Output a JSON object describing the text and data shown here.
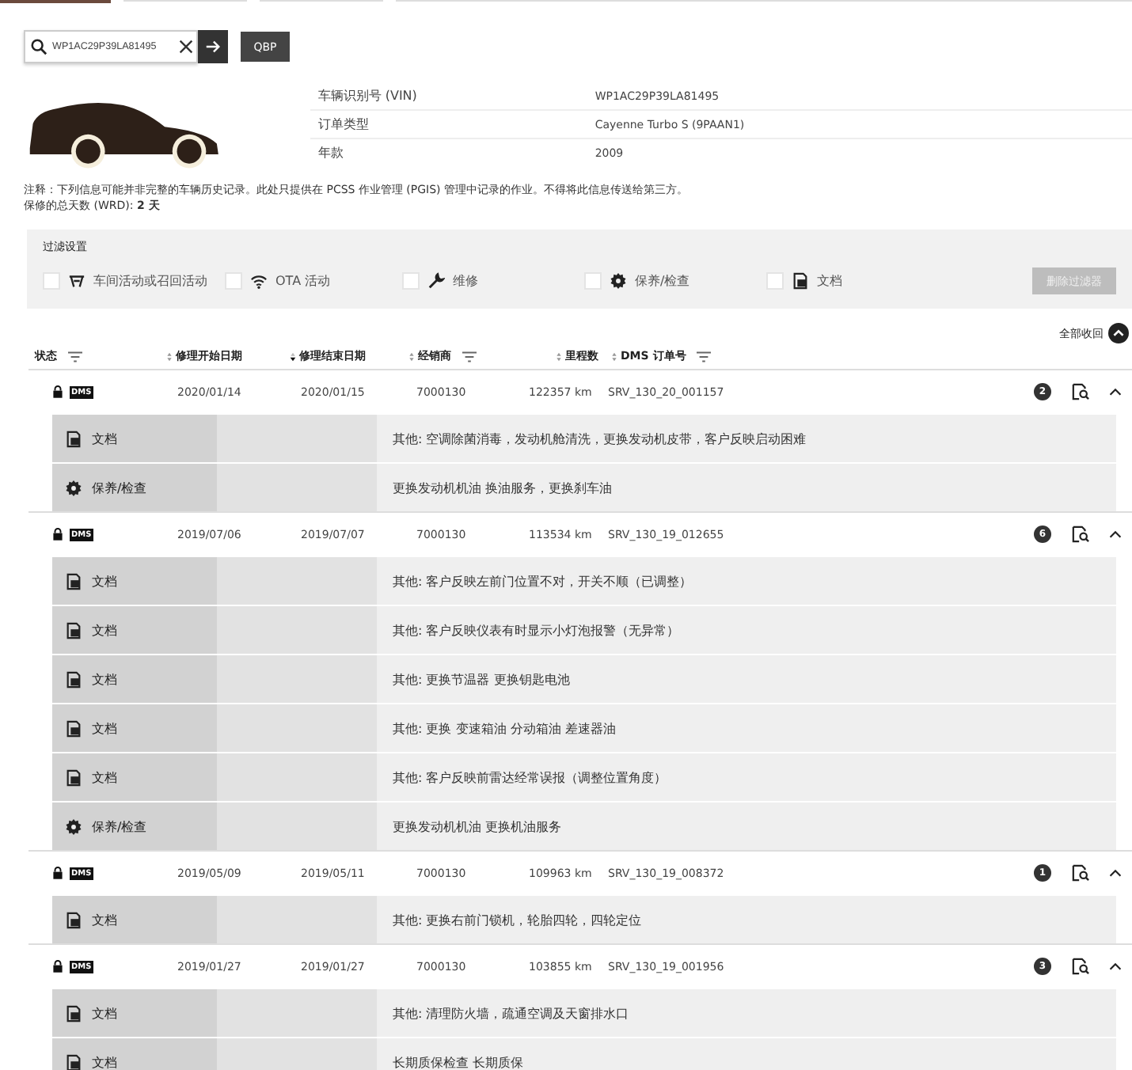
{
  "search": {
    "value": "WP1AC29P39LA81495"
  },
  "qbp_button": "QBP",
  "vehicle": [
    {
      "label": "车辆识别号 (VIN)",
      "value": "WP1AC29P39LA81495"
    },
    {
      "label": "订单类型",
      "value": "Cayenne Turbo S (9PAAN1)"
    },
    {
      "label": "年款",
      "value": "2009"
    }
  ],
  "note": "注释：下列信息可能并非完整的车辆历史记录。此处只提供在 PCSS 作业管理 (PGIS) 管理中记录的作业。不得将此信息传送给第三方。",
  "warranty": "保修的总天数 (WRD): **2 天**",
  "filters": {
    "title": "过滤设置",
    "options": [
      {
        "kind": "workshop",
        "label": "车间活动或召回活动",
        "checked": false
      },
      {
        "kind": "ota",
        "label": "OTA 活动",
        "checked": false
      },
      {
        "kind": "repair",
        "label": "维修",
        "checked": false
      },
      {
        "kind": "maintenance",
        "label": "保养/检查",
        "checked": false
      },
      {
        "kind": "document",
        "label": "文档",
        "checked": false
      }
    ],
    "reset_button": {
      "label": "删除过滤器",
      "disabled": true
    }
  },
  "collapse_all": "全部收回",
  "columns": [
    {
      "label": "状态",
      "sortable": false,
      "filter": true
    },
    {
      "label": "修理开始日期",
      "sortable": true,
      "sorted": false,
      "filter": false
    },
    {
      "label": "修理结束日期",
      "sortable": true,
      "sorted": true,
      "filter": false
    },
    {
      "label": "经销商",
      "sortable": true,
      "sorted": false,
      "filter": true
    },
    {
      "label": "里程数",
      "sortable": true,
      "sorted": false,
      "filter": false
    },
    {
      "label": "DMS 订单号",
      "sortable": true,
      "sorted": false,
      "filter": true
    }
  ],
  "records": [
    {
      "locked": true,
      "source": "DMS",
      "start": "2020/01/14",
      "end": "2020/01/15",
      "dealer": "7000130",
      "mileage": "122357 km",
      "order": "SRV_130_20_001157",
      "count": "2",
      "expanded": true,
      "entries": [
        {
          "kind": "document",
          "type": "文档",
          "description": "其他: 空调除菌消毒，发动机舱清洗，更换发动机皮带，客户反映启动困难"
        },
        {
          "kind": "maintenance",
          "type": "保养/检查",
          "description": "更换发动机机油 换油服务，更换刹车油"
        }
      ]
    },
    {
      "locked": true,
      "source": "DMS",
      "start": "2019/07/06",
      "end": "2019/07/07",
      "dealer": "7000130",
      "mileage": "113534 km",
      "order": "SRV_130_19_012655",
      "count": "6",
      "expanded": true,
      "entries": [
        {
          "kind": "document",
          "type": "文档",
          "description": "其他: 客户反映左前门位置不对，开关不顺（已调整）"
        },
        {
          "kind": "document",
          "type": "文档",
          "description": "其他: 客户反映仪表有时显示小灯泡报警（无异常）"
        },
        {
          "kind": "document",
          "type": "文档",
          "description": "其他: 更换节温器 更换钥匙电池"
        },
        {
          "kind": "document",
          "type": "文档",
          "description": "其他: 更换 变速箱油 分动箱油 差速器油"
        },
        {
          "kind": "document",
          "type": "文档",
          "description": "其他: 客户反映前雷达经常误报（调整位置角度）"
        },
        {
          "kind": "maintenance",
          "type": "保养/检查",
          "description": "更换发动机机油 更换机油服务"
        }
      ]
    },
    {
      "locked": true,
      "source": "DMS",
      "start": "2019/05/09",
      "end": "2019/05/11",
      "dealer": "7000130",
      "mileage": "109963 km",
      "order": "SRV_130_19_008372",
      "count": "1",
      "expanded": true,
      "entries": [
        {
          "kind": "document",
          "type": "文档",
          "description": "其他: 更换右前门锁机，轮胎四轮，四轮定位"
        }
      ]
    },
    {
      "locked": true,
      "source": "DMS",
      "start": "2019/01/27",
      "end": "2019/01/27",
      "dealer": "7000130",
      "mileage": "103855 km",
      "order": "SRV_130_19_001956",
      "count": "3",
      "expanded": true,
      "entries": [
        {
          "kind": "document",
          "type": "文档",
          "description": "其他: 清理防火墙，疏通空调及天窗排水口"
        },
        {
          "kind": "document",
          "type": "文档",
          "description": "长期质保检查 长期质保"
        }
      ]
    }
  ]
}
